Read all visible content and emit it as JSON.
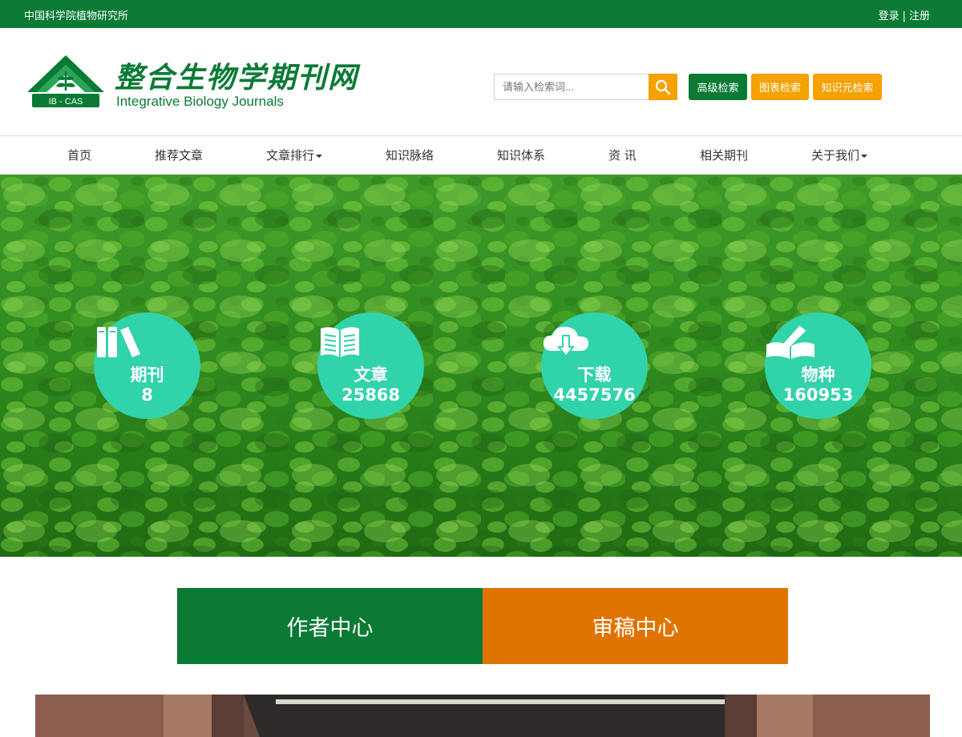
{
  "topbar": {
    "org": "中国科学院植物研究所",
    "login": "登录",
    "separator": "|",
    "register": "注册"
  },
  "brand": {
    "logo_text": "IB - CAS",
    "title_cn": "整合生物学期刊网",
    "title_en": "Integrative Biology Journals"
  },
  "search": {
    "placeholder": "请输入检索词...",
    "advanced": "高级检索",
    "chart_search": "图表检索",
    "knowledge_search": "知识元检索"
  },
  "nav": {
    "items": [
      {
        "label": "首页"
      },
      {
        "label": "推荐文章"
      },
      {
        "label": "文章排行",
        "dropdown": true
      },
      {
        "label": "知识脉络"
      },
      {
        "label": "知识体系"
      },
      {
        "label": "资 讯"
      },
      {
        "label": "相关期刊"
      },
      {
        "label": "关于我们",
        "dropdown": true
      }
    ]
  },
  "stats": [
    {
      "label": "期刊",
      "value": "8",
      "icon": "books-icon"
    },
    {
      "label": "文章",
      "value": "25868",
      "icon": "open-book-icon"
    },
    {
      "label": "下载",
      "value": "4457576",
      "icon": "cloud-download-icon"
    },
    {
      "label": "物种",
      "value": "160953",
      "icon": "book-pen-icon"
    }
  ],
  "centers": {
    "author": "作者中心",
    "review": "审稿中心"
  },
  "colors": {
    "brand_green": "#0a7a35",
    "accent_orange": "#f5a100",
    "review_orange": "#e07400",
    "stat_teal": "#31d3aa"
  }
}
